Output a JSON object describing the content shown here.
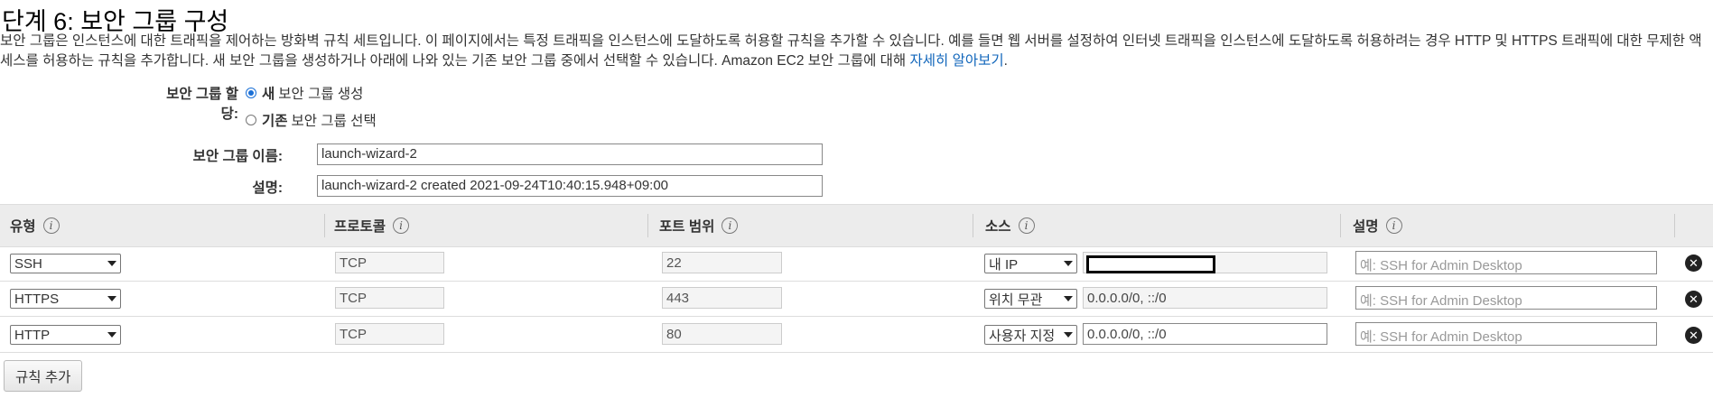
{
  "title": "단계 6: 보안 그룹 구성",
  "description": {
    "text": "보안 그룹은 인스턴스에 대한 트래픽을 제어하는 방화벽 규칙 세트입니다. 이 페이지에서는 특정 트래픽을 인스턴스에 도달하도록 허용할 규칙을 추가할 수 있습니다. 예를 들면 웹 서버를 설정하여 인터넷 트래픽을 인스턴스에 도달하도록 허용하려는 경우 HTTP 및 HTTPS 트래픽에 대한 무제한 액세스를 허용하는 규칙을 추가합니다. 새 보안 그룹을 생성하거나 아래에 나와 있는 기존 보안 그룹 중에서 선택할 수 있습니다. Amazon EC2 보안 그룹에 대해 ",
    "link": "자세히 알아보기",
    "end": "."
  },
  "assign": {
    "label": "보안 그룹 할당:",
    "options": [
      {
        "bold": "새",
        "rest": "보안 그룹 생성",
        "selected": true
      },
      {
        "bold": "기존",
        "rest": "보안 그룹 선택",
        "selected": false
      }
    ]
  },
  "name_field": {
    "label": "보안 그룹 이름:",
    "value": "launch-wizard-2"
  },
  "desc_field": {
    "label": "설명:",
    "value": "launch-wizard-2 created 2021-09-24T10:40:15.948+09:00"
  },
  "table": {
    "headers": [
      "유형",
      "프로토콜",
      "포트 범위",
      "소스",
      "설명"
    ],
    "info_glyph": "i",
    "rows": [
      {
        "type": "SSH",
        "protocol": "TCP",
        "port": "22",
        "source_select": "내 IP",
        "source_value": "",
        "desc_placeholder": "예: SSH for Admin Desktop"
      },
      {
        "type": "HTTPS",
        "protocol": "TCP",
        "port": "443",
        "source_select": "위치 무관",
        "source_value": "0.0.0.0/0, ::/0",
        "desc_placeholder": "예: SSH for Admin Desktop"
      },
      {
        "type": "HTTP",
        "protocol": "TCP",
        "port": "80",
        "source_select": "사용자 지정",
        "source_value": "0.0.0.0/0, ::/0",
        "desc_placeholder": "예: SSH for Admin Desktop"
      }
    ],
    "remove_glyph": "✕"
  },
  "add_rule_label": "규칙 추가",
  "colors": {
    "link": "#1166bb",
    "radio_selected": "#1a6fd6",
    "header_bg": "#ececec"
  }
}
